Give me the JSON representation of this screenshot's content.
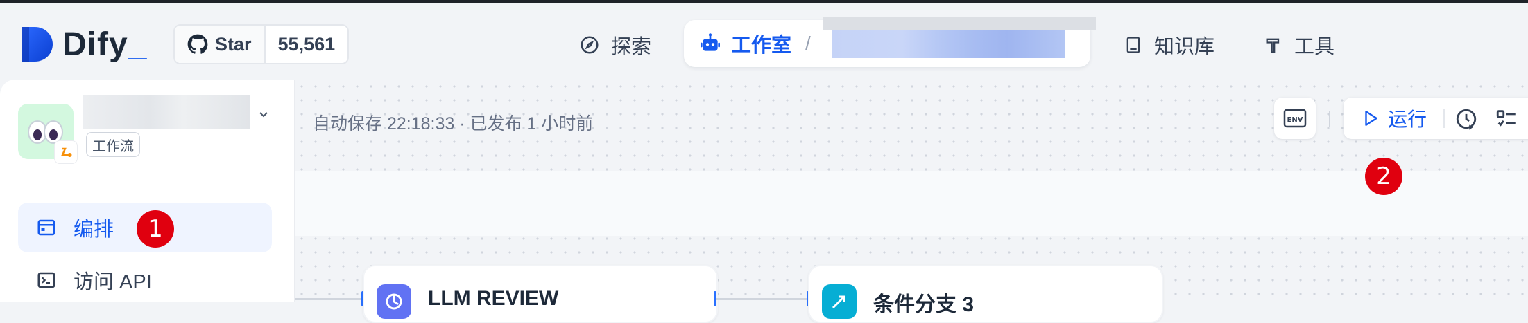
{
  "brand": {
    "name_main": "Dify",
    "name_suffix": "_"
  },
  "github": {
    "star_label": "Star",
    "star_count": "55,561"
  },
  "nav": {
    "explore": "探索",
    "studio": "工作室",
    "separator": "/",
    "knowledge": "知识库",
    "tools": "工具"
  },
  "app": {
    "type_tag": "工作流"
  },
  "sidebar": {
    "items": [
      {
        "label": "编排",
        "active": true
      },
      {
        "label": "访问 API",
        "active": false
      }
    ]
  },
  "toolbar": {
    "save_status": "自动保存 22:18:33 · 已发布 1 小时前",
    "env_label": "ENV",
    "run_label": "运行"
  },
  "nodes": [
    {
      "title": "LLM REVIEW",
      "icon": "llm-icon",
      "color": "#6172f3"
    },
    {
      "title": "条件分支 3",
      "icon": "if-else-icon",
      "color": "#06aed4"
    }
  ],
  "markers": [
    "1",
    "2"
  ],
  "colors": {
    "accent": "#155aef",
    "marker": "#e0000f",
    "active_bg": "#eff4ff"
  }
}
